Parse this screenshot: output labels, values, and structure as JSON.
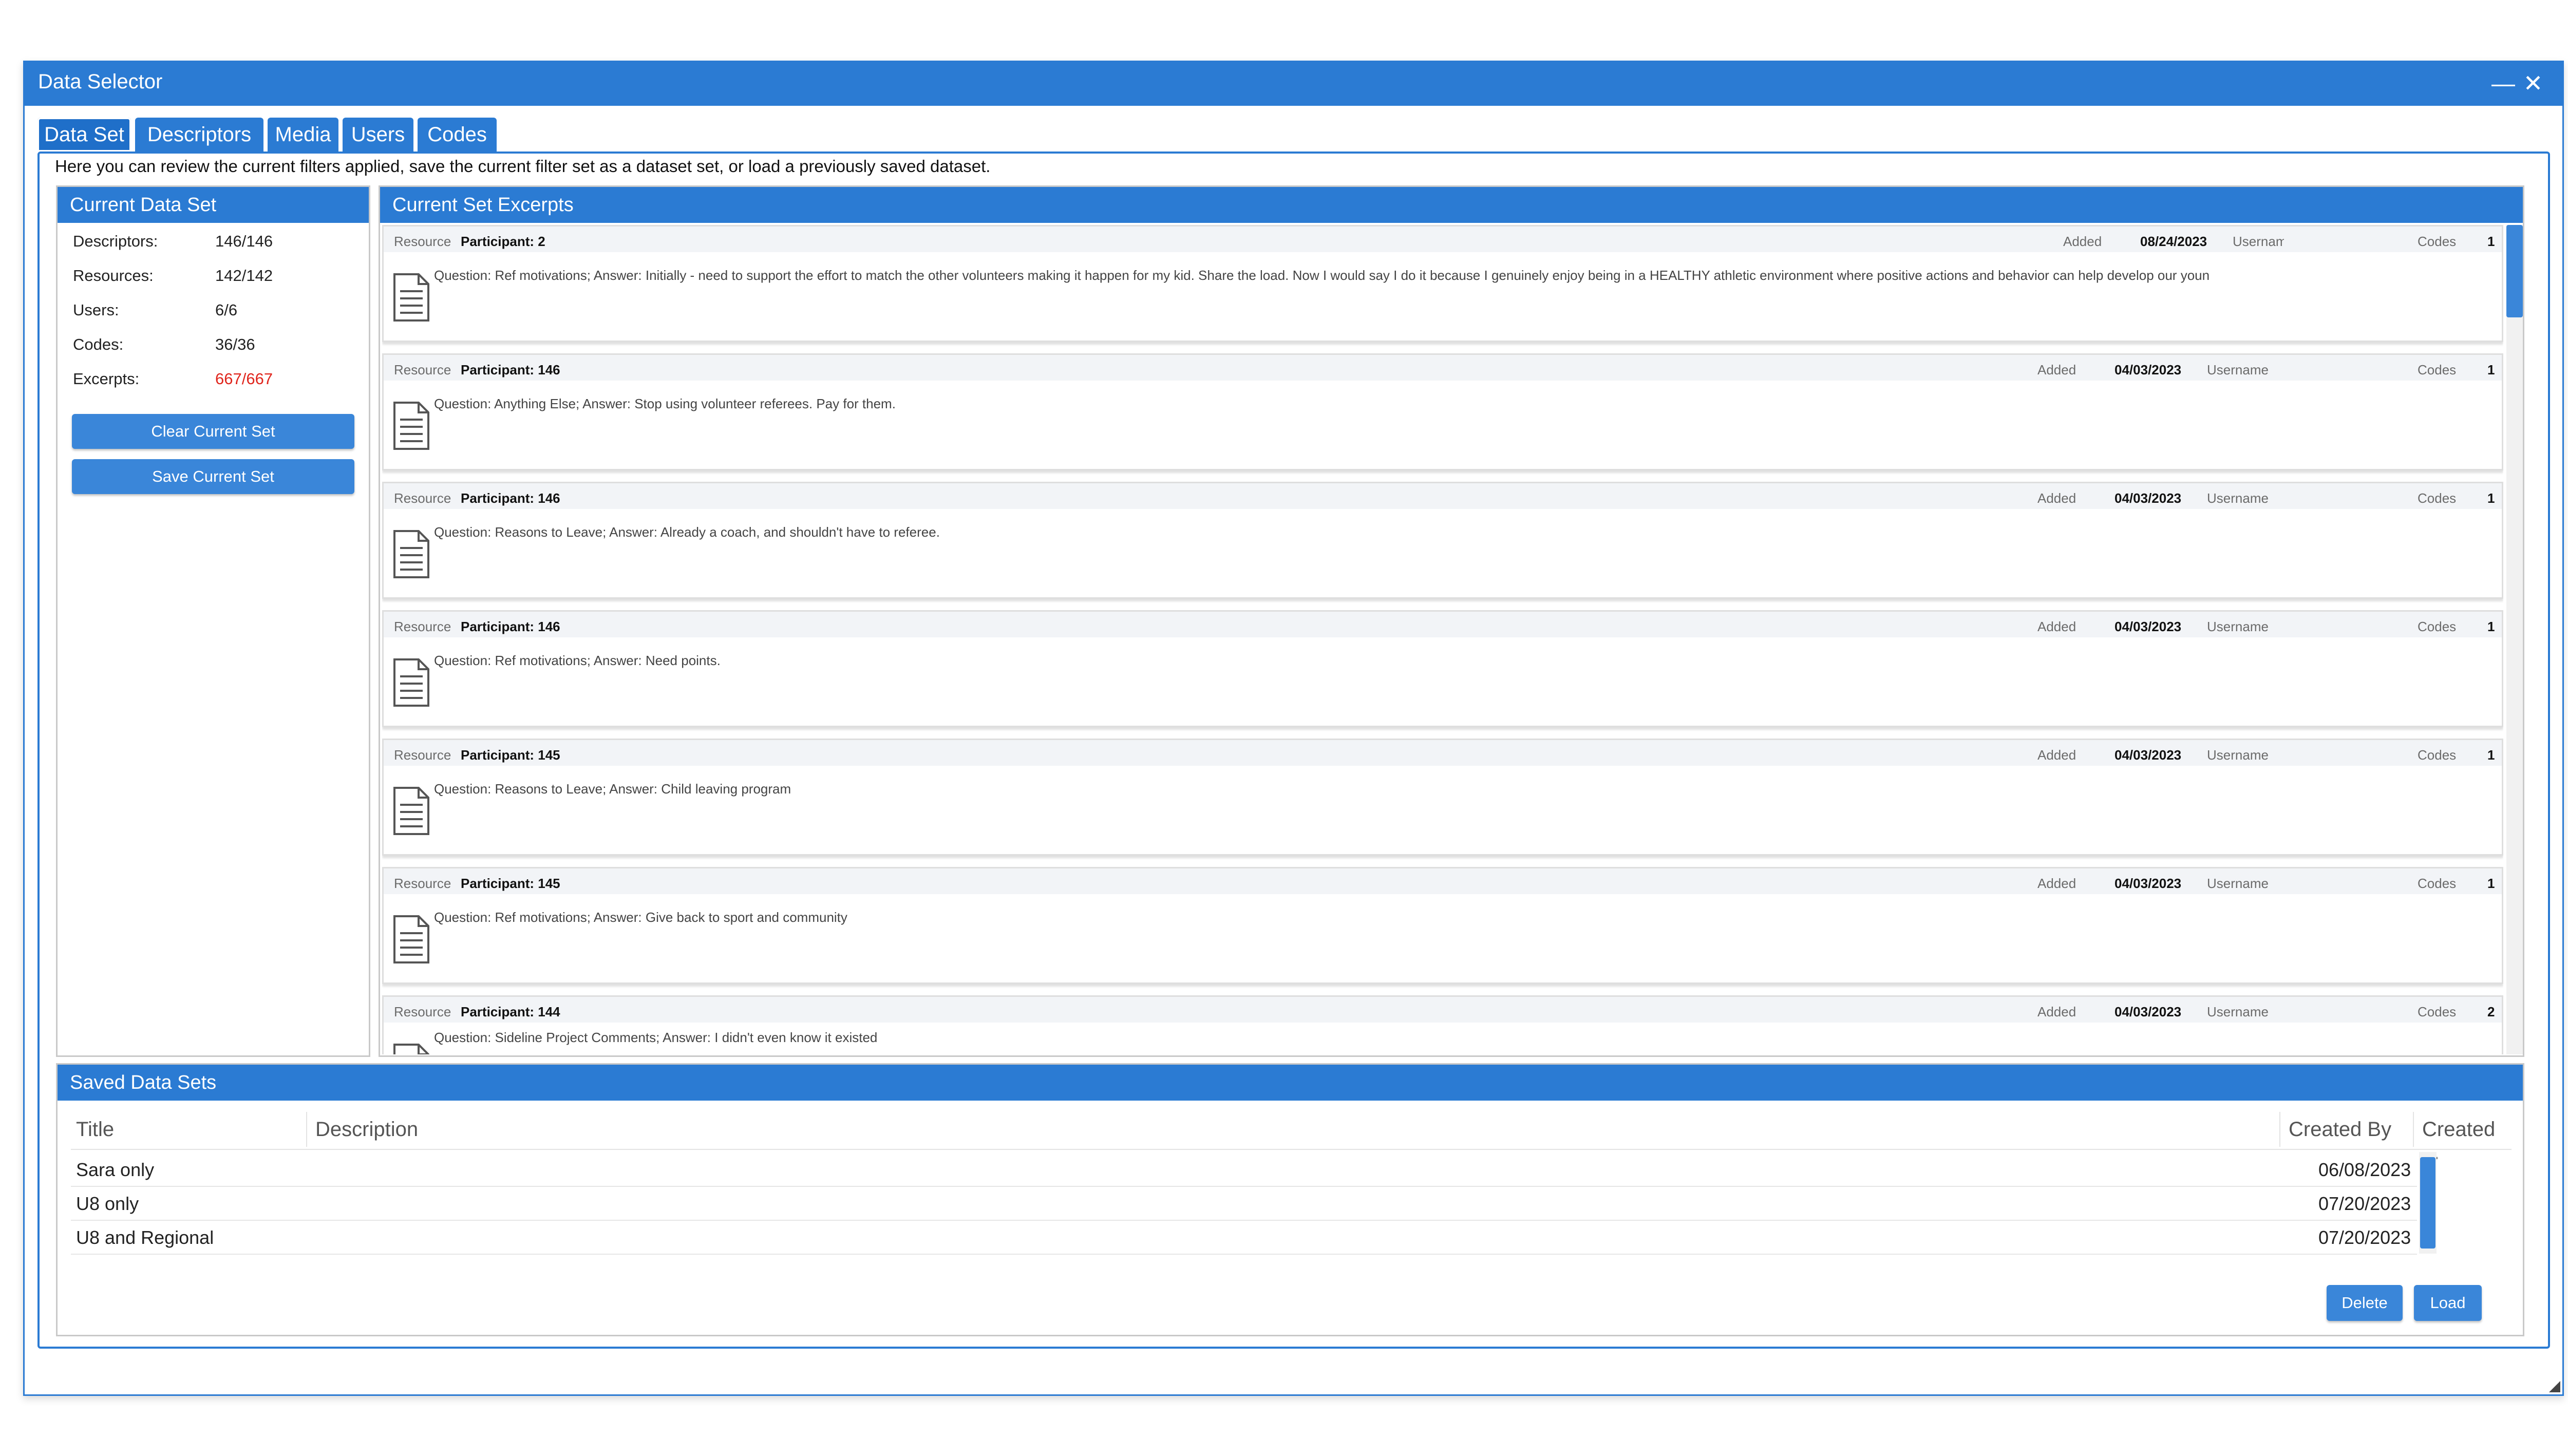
{
  "window": {
    "title": "Data Selector",
    "minimize": "—",
    "close": "✕"
  },
  "tabs": [
    "Data Set",
    "Descriptors",
    "Media",
    "Users",
    "Codes"
  ],
  "intro": "Here you can review the current filters applied, save the current filter set as a dataset set, or load a previously saved dataset.",
  "current_set": {
    "title": "Current Data Set",
    "stats": [
      {
        "label": "Descriptors:",
        "value": "146/146"
      },
      {
        "label": "Resources:",
        "value": "142/142"
      },
      {
        "label": "Users:",
        "value": "6/6"
      },
      {
        "label": "Codes:",
        "value": "36/36"
      },
      {
        "label": "Excerpts:",
        "value": "667/667"
      }
    ],
    "clear_label": "Clear Current Set",
    "save_label": "Save Current Set"
  },
  "excerpts": {
    "title": "Current Set Excerpts",
    "labels": {
      "resource": "Resource",
      "added": "Added",
      "username": "Username",
      "codes": "Codes"
    },
    "items": [
      {
        "participant": "Participant: 2",
        "added": "08/24/2023",
        "username": "Usernam",
        "codes": "1",
        "text": "Question: Ref motivations; Answer: Initially - need to support the effort to match the other volunteers making it happen for my kid. Share the load. Now I would say I do it because I genuinely enjoy being in a HEALTHY athletic environment where positive actions and behavior can help develop our youn"
      },
      {
        "participant": "Participant: 146",
        "added": "04/03/2023",
        "username": "Username",
        "codes": "1",
        "text": "Question: Anything Else; Answer: Stop using volunteer referees. Pay for them."
      },
      {
        "participant": "Participant: 146",
        "added": "04/03/2023",
        "username": "Username",
        "codes": "1",
        "text": "Question: Reasons to Leave; Answer: Already a coach, and shouldn't have to referee."
      },
      {
        "participant": "Participant: 146",
        "added": "04/03/2023",
        "username": "Username",
        "codes": "1",
        "text": "Question: Ref motivations; Answer: Need points."
      },
      {
        "participant": "Participant: 145",
        "added": "04/03/2023",
        "username": "Username",
        "codes": "1",
        "text": "Question: Reasons to Leave; Answer: Child leaving program"
      },
      {
        "participant": "Participant: 145",
        "added": "04/03/2023",
        "username": "Username",
        "codes": "1",
        "text": "Question: Ref motivations; Answer: Give back to sport and community"
      },
      {
        "participant": "Participant: 144",
        "added": "04/03/2023",
        "username": "Username",
        "codes": "2",
        "text": "Question: Sideline Project Comments; Answer: I didn't even know it existed"
      }
    ]
  },
  "saved_sets": {
    "title": "Saved Data Sets",
    "columns": {
      "title": "Title",
      "description": "Description",
      "created_by": "Created By",
      "created": "Created ..."
    },
    "rows": [
      {
        "title": "Sara only",
        "description": "",
        "created_by": "",
        "created": "06/08/2023"
      },
      {
        "title": "U8 only",
        "description": "",
        "created_by": "",
        "created": "07/20/2023"
      },
      {
        "title": "U8 and Regional",
        "description": "",
        "created_by": "",
        "created": "07/20/2023"
      }
    ],
    "delete_label": "Delete",
    "load_label": "Load"
  },
  "colors": {
    "accent": "#2b7bd3",
    "alert": "#e0241b"
  }
}
